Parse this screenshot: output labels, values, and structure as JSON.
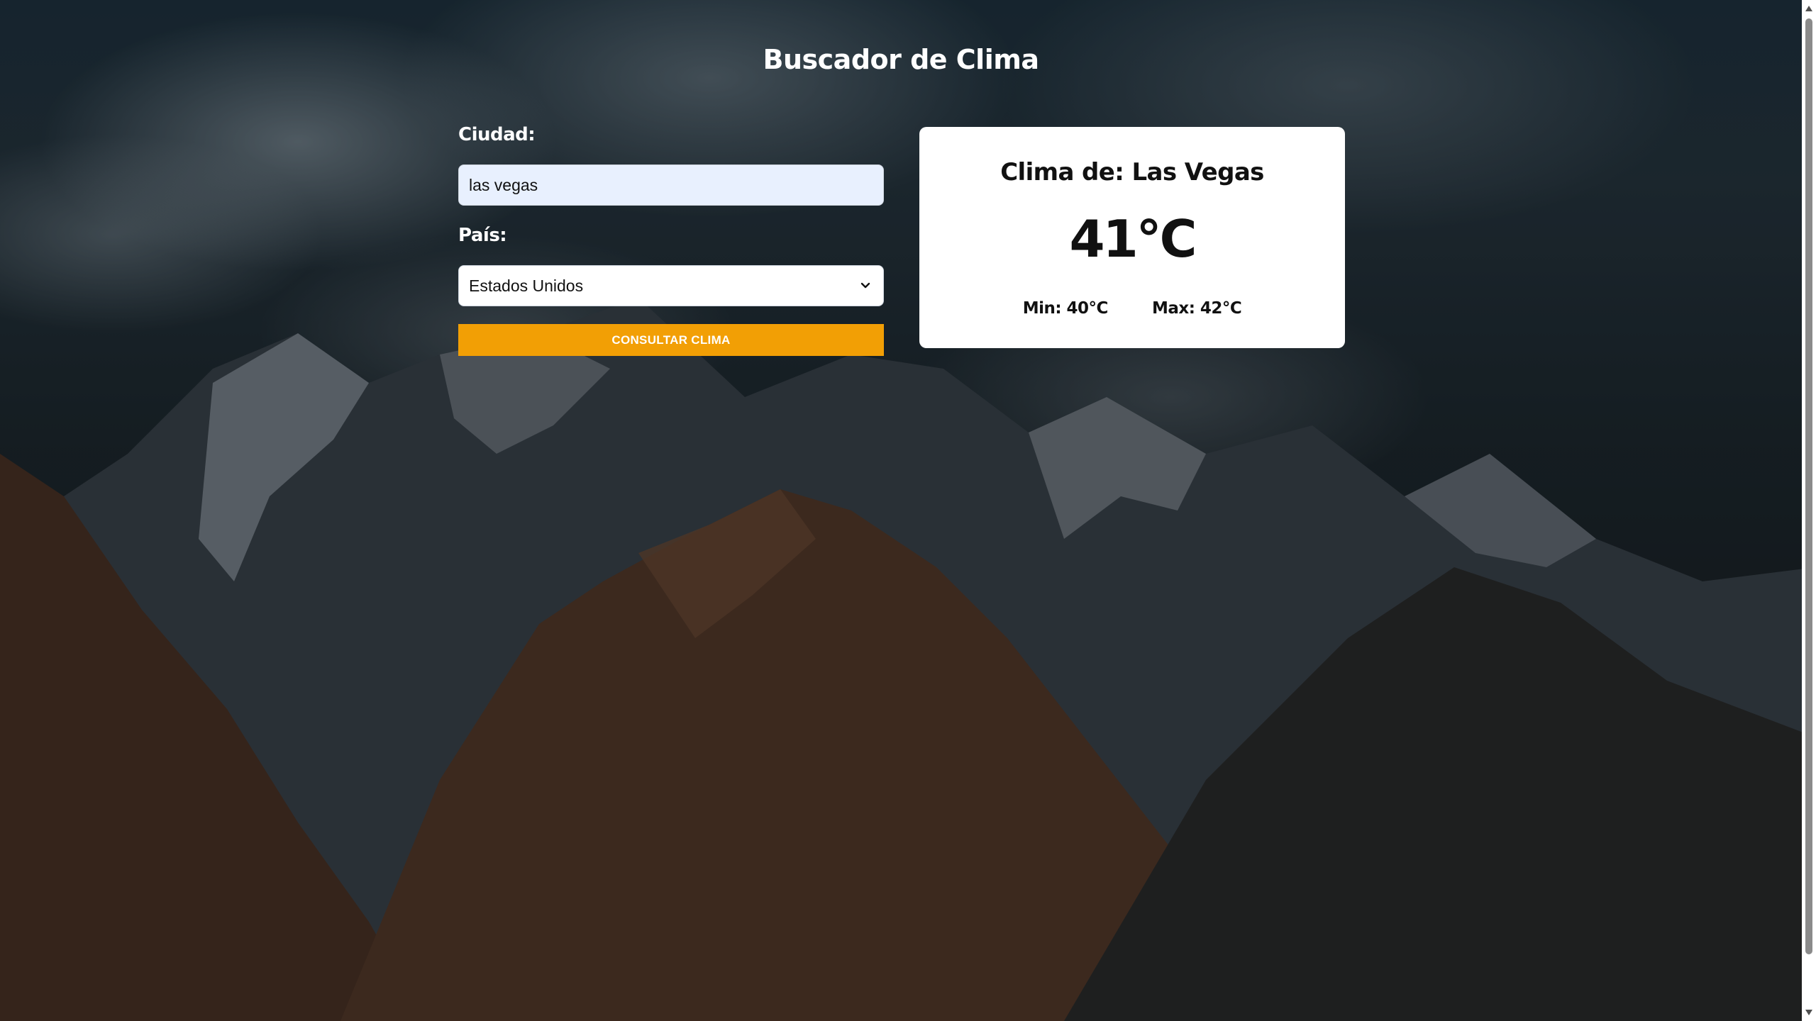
{
  "page": {
    "title": "Buscador de Clima"
  },
  "form": {
    "city_label": "Ciudad:",
    "city_value": "las vegas",
    "country_label": "País:",
    "country_selected": "Estados Unidos",
    "submit_label": "CONSULTAR CLIMA"
  },
  "result": {
    "title": "Clima de: Las Vegas",
    "temperature": "41°C",
    "min": "Min: 40°C",
    "max": "Max: 42°C"
  },
  "colors": {
    "accent": "#f29f05",
    "input_autofill": "#e8f0fe",
    "card": "#ffffff"
  },
  "icons": {
    "select_chevron": "chevron-down-icon",
    "scroll_up": "scroll-up-arrow-icon",
    "scroll_down": "scroll-down-arrow-icon"
  }
}
